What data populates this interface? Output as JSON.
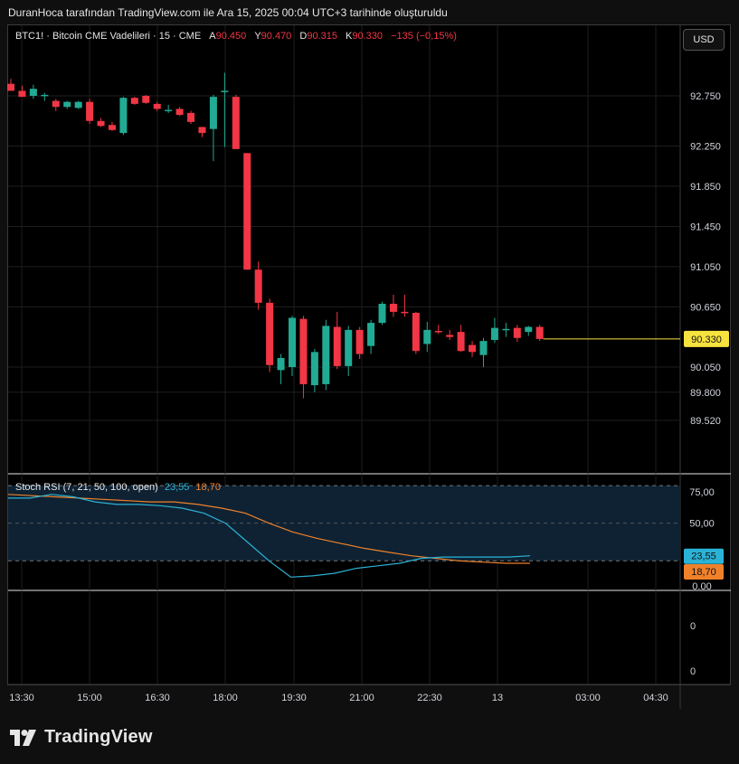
{
  "header": {
    "caption": "DuranHoca tarafından TradingView.com ile Ara 15, 2025 00:04 UTC+3 tarihinde oluşturuldu"
  },
  "legend": {
    "symbol": "BTC1! · Bitcoin CME Vadelileri · 15 · CME",
    "open_label": "A",
    "open": "90.450",
    "high_label": "Y",
    "high": "90.470",
    "low_label": "D",
    "low": "90.315",
    "close_label": "K",
    "close": "90.330",
    "change": "−135 (−0,15%)"
  },
  "currency_button": "USD",
  "stoch_legend": {
    "name": "Stoch RSI (7, 21, 50, 100, open)",
    "k": "23,55",
    "d": "18,70"
  },
  "logo": {
    "text": "TradingView",
    "icon": "tradingview-logo-icon"
  },
  "colors": {
    "up": "#22ab94",
    "down": "#f23645",
    "last_price": "#f7e33e",
    "stoch_k": "#2bb3d6",
    "stoch_d": "#f0812b",
    "band_fill": "#0e2233"
  },
  "chart_data": [
    {
      "type": "candlestick",
      "title": "BTC1! · Bitcoin CME Vadelileri · 15 · CME",
      "ylim": [
        89.3,
        93.2
      ],
      "y_ticks": [
        "92.750",
        "92.250",
        "91.850",
        "91.450",
        "91.050",
        "90.650",
        "90.050",
        "89.800",
        "89.520"
      ],
      "y_tick_values": [
        92.75,
        92.25,
        91.85,
        91.45,
        91.05,
        90.65,
        90.05,
        89.8,
        89.52
      ],
      "x_ticks": [
        "13:30",
        "15:00",
        "16:30",
        "18:00",
        "19:30",
        "21:00",
        "22:30",
        "13",
        "03:00",
        "04:30"
      ],
      "last_price_label": "90.330",
      "last_price": 90.33,
      "candles": [
        {
          "o": 92.87,
          "h": 92.92,
          "l": 92.8,
          "c": 92.8
        },
        {
          "o": 92.8,
          "h": 92.85,
          "l": 92.74,
          "c": 92.74
        },
        {
          "o": 92.75,
          "h": 92.86,
          "l": 92.72,
          "c": 92.82
        },
        {
          "o": 92.76,
          "h": 92.78,
          "l": 92.7,
          "c": 92.76
        },
        {
          "o": 92.7,
          "h": 92.72,
          "l": 92.6,
          "c": 92.64
        },
        {
          "o": 92.64,
          "h": 92.7,
          "l": 92.62,
          "c": 92.69
        },
        {
          "o": 92.63,
          "h": 92.7,
          "l": 92.62,
          "c": 92.69
        },
        {
          "o": 92.69,
          "h": 92.72,
          "l": 92.47,
          "c": 92.5
        },
        {
          "o": 92.5,
          "h": 92.53,
          "l": 92.44,
          "c": 92.45
        },
        {
          "o": 92.46,
          "h": 92.49,
          "l": 92.4,
          "c": 92.41
        },
        {
          "o": 92.38,
          "h": 92.74,
          "l": 92.36,
          "c": 92.73
        },
        {
          "o": 92.73,
          "h": 92.74,
          "l": 92.66,
          "c": 92.67
        },
        {
          "o": 92.75,
          "h": 92.76,
          "l": 92.67,
          "c": 92.68
        },
        {
          "o": 92.67,
          "h": 92.69,
          "l": 92.6,
          "c": 92.62
        },
        {
          "o": 92.61,
          "h": 92.66,
          "l": 92.58,
          "c": 92.61
        },
        {
          "o": 92.62,
          "h": 92.64,
          "l": 92.55,
          "c": 92.56
        },
        {
          "o": 92.58,
          "h": 92.6,
          "l": 92.47,
          "c": 92.49
        },
        {
          "o": 92.44,
          "h": 92.44,
          "l": 92.34,
          "c": 92.38
        },
        {
          "o": 92.42,
          "h": 92.76,
          "l": 92.1,
          "c": 92.74
        },
        {
          "o": 92.8,
          "h": 92.98,
          "l": 92.24,
          "c": 92.8
        },
        {
          "o": 92.74,
          "h": 92.76,
          "l": 92.22,
          "c": 92.22
        },
        {
          "o": 92.18,
          "h": 92.18,
          "l": 91.02,
          "c": 91.02
        },
        {
          "o": 91.02,
          "h": 91.1,
          "l": 90.62,
          "c": 90.69
        },
        {
          "o": 90.69,
          "h": 90.73,
          "l": 90.0,
          "c": 90.07
        },
        {
          "o": 90.02,
          "h": 90.18,
          "l": 89.88,
          "c": 90.14
        },
        {
          "o": 90.05,
          "h": 90.56,
          "l": 89.96,
          "c": 90.54
        },
        {
          "o": 90.53,
          "h": 90.56,
          "l": 89.74,
          "c": 89.88
        },
        {
          "o": 89.87,
          "h": 90.23,
          "l": 89.8,
          "c": 90.2
        },
        {
          "o": 89.88,
          "h": 90.52,
          "l": 89.82,
          "c": 90.46
        },
        {
          "o": 90.45,
          "h": 90.6,
          "l": 90.03,
          "c": 90.06
        },
        {
          "o": 90.06,
          "h": 90.46,
          "l": 89.96,
          "c": 90.42
        },
        {
          "o": 90.42,
          "h": 90.45,
          "l": 90.13,
          "c": 90.18
        },
        {
          "o": 90.26,
          "h": 90.52,
          "l": 90.18,
          "c": 90.49
        },
        {
          "o": 90.49,
          "h": 90.7,
          "l": 90.47,
          "c": 90.68
        },
        {
          "o": 90.68,
          "h": 90.77,
          "l": 90.55,
          "c": 90.6
        },
        {
          "o": 90.6,
          "h": 90.77,
          "l": 90.55,
          "c": 90.59
        },
        {
          "o": 90.59,
          "h": 90.6,
          "l": 90.18,
          "c": 90.21
        },
        {
          "o": 90.28,
          "h": 90.5,
          "l": 90.2,
          "c": 90.42
        },
        {
          "o": 90.41,
          "h": 90.47,
          "l": 90.38,
          "c": 90.4
        },
        {
          "o": 90.37,
          "h": 90.42,
          "l": 90.32,
          "c": 90.35
        },
        {
          "o": 90.4,
          "h": 90.47,
          "l": 90.2,
          "c": 90.21
        },
        {
          "o": 90.27,
          "h": 90.31,
          "l": 90.15,
          "c": 90.2
        },
        {
          "o": 90.17,
          "h": 90.34,
          "l": 90.05,
          "c": 90.31
        },
        {
          "o": 90.32,
          "h": 90.54,
          "l": 90.29,
          "c": 90.44
        },
        {
          "o": 90.42,
          "h": 90.49,
          "l": 90.35,
          "c": 90.43
        },
        {
          "o": 90.44,
          "h": 90.47,
          "l": 90.3,
          "c": 90.34
        },
        {
          "o": 90.4,
          "h": 90.46,
          "l": 90.36,
          "c": 90.45
        },
        {
          "o": 90.45,
          "h": 90.47,
          "l": 90.31,
          "c": 90.33
        }
      ]
    },
    {
      "type": "line",
      "title": "Stoch RSI (7, 21, 50, 100, open)",
      "ylim": [
        0,
        100
      ],
      "y_ticks": [
        "75,00",
        "50,00",
        "0.00"
      ],
      "y_tick_values": [
        75,
        50,
        0
      ],
      "bands": [
        80,
        20
      ],
      "series": [
        {
          "name": "K",
          "last_label": "23,55",
          "values": [
            70,
            70,
            73,
            71,
            67,
            65,
            65,
            64,
            62,
            58,
            50,
            35,
            20,
            7,
            8,
            10,
            14,
            16,
            18,
            22,
            23,
            23,
            23,
            23,
            24
          ]
        },
        {
          "name": "D",
          "last_label": "18,70",
          "values": [
            73,
            72,
            71,
            70,
            69,
            68,
            67,
            67,
            65,
            62,
            58,
            50,
            43,
            38,
            34,
            30,
            27,
            24,
            22,
            20,
            19,
            18,
            18
          ]
        }
      ]
    },
    {
      "type": "line",
      "ylim": [
        0,
        1
      ],
      "y_ticks": [
        "0",
        "0"
      ],
      "series": []
    }
  ]
}
